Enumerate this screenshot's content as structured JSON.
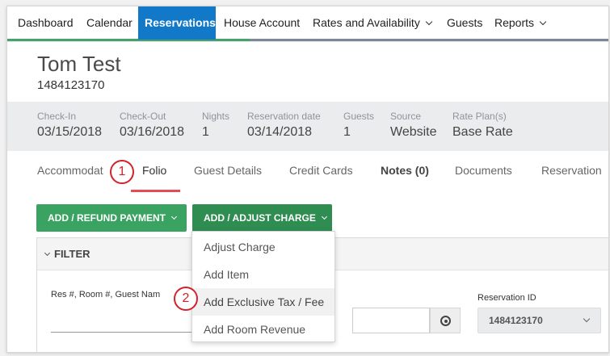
{
  "nav": {
    "items": [
      {
        "label": "Dashboard"
      },
      {
        "label": "Calendar"
      },
      {
        "label": "Reservations"
      },
      {
        "label": "House Account"
      },
      {
        "label": "Rates and Availability"
      },
      {
        "label": "Guests"
      },
      {
        "label": "Reports"
      }
    ],
    "active": "Reservations"
  },
  "guest": {
    "name": "Tom Test",
    "id": "1484123170"
  },
  "summary": [
    {
      "label": "Check-In",
      "value": "03/15/2018"
    },
    {
      "label": "Check-Out",
      "value": "03/16/2018"
    },
    {
      "label": "Nights",
      "value": "1"
    },
    {
      "label": "Reservation date",
      "value": "03/14/2018"
    },
    {
      "label": "Guests",
      "value": "1"
    },
    {
      "label": "Source",
      "value": "Website"
    },
    {
      "label": "Rate Plan(s)",
      "value": "Base Rate"
    }
  ],
  "tabs": [
    {
      "label": "Accommodat"
    },
    {
      "label": "Folio"
    },
    {
      "label": "Guest Details"
    },
    {
      "label": "Credit Cards"
    },
    {
      "label": "Notes (0)"
    },
    {
      "label": "Documents"
    },
    {
      "label": "Reservation"
    }
  ],
  "active_tab": "Folio",
  "actions": {
    "refund_label": "ADD / REFUND PAYMENT",
    "charge_label": "ADD / ADJUST CHARGE"
  },
  "charge_menu": [
    {
      "label": "Adjust Charge"
    },
    {
      "label": "Add Item"
    },
    {
      "label": "Add Exclusive Tax / Fee"
    },
    {
      "label": "Add Room Revenue"
    }
  ],
  "filter": {
    "title": "FILTER",
    "search_label": "Res #, Room #, Guest Nam",
    "reservation_id_label": "Reservation ID",
    "reservation_id_value": "1484123170"
  },
  "callouts": {
    "one": "1",
    "two": "2"
  },
  "colors": {
    "accent_blue": "#1279c9",
    "accent_green": "#3aa362",
    "callout_red": "#d2232a",
    "tab_underline": "#e64a55"
  }
}
